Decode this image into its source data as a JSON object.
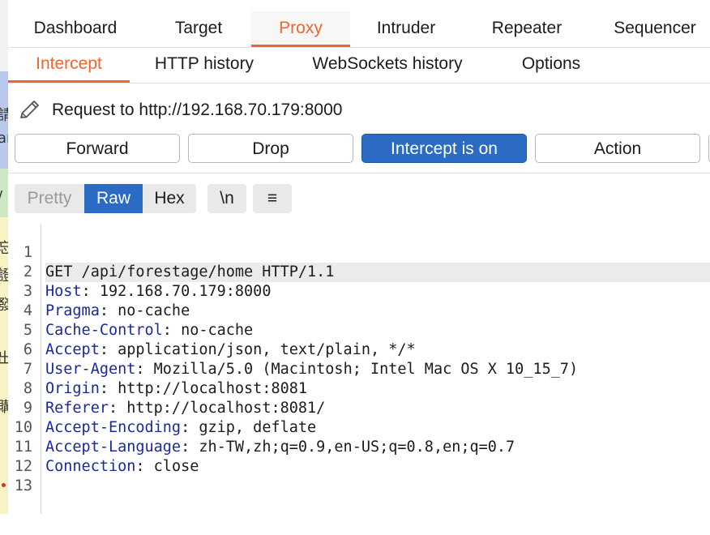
{
  "tabs": [
    {
      "label": "Dashboard"
    },
    {
      "label": "Target"
    },
    {
      "label": "Proxy"
    },
    {
      "label": "Intruder"
    },
    {
      "label": "Repeater"
    },
    {
      "label": "Sequencer"
    }
  ],
  "active_tab": "Proxy",
  "subtabs": [
    {
      "label": "Intercept"
    },
    {
      "label": "HTTP history"
    },
    {
      "label": "WebSockets history"
    },
    {
      "label": "Options"
    }
  ],
  "active_subtab": "Intercept",
  "request_title": "Request to http://192.168.70.179:8000",
  "buttons": {
    "forward": "Forward",
    "drop": "Drop",
    "intercept": "Intercept is on",
    "action": "Action"
  },
  "editor_modes": {
    "pretty": "Pretty",
    "raw": "Raw",
    "hex": "Hex",
    "newline": "\\n",
    "menu": "≡"
  },
  "active_mode": "Raw",
  "lines": [
    {
      "num": "1",
      "header": "",
      "value": "GET /api/forestage/home HTTP/1.1"
    },
    {
      "num": "2",
      "header": "Host",
      "value": ": 192.168.70.179:8000"
    },
    {
      "num": "3",
      "header": "Pragma",
      "value": ": no-cache"
    },
    {
      "num": "4",
      "header": "Cache-Control",
      "value": ": no-cache"
    },
    {
      "num": "5",
      "header": "Accept",
      "value": ": application/json, text/plain, */*"
    },
    {
      "num": "6",
      "header": "User-Agent",
      "value": ": Mozilla/5.0 (Macintosh; Intel Mac OS X 10_15_7)"
    },
    {
      "num": "7",
      "header": "Origin",
      "value": ": http://localhost:8081"
    },
    {
      "num": "8",
      "header": "Referer",
      "value": ": http://localhost:8081/"
    },
    {
      "num": "9",
      "header": "Accept-Encoding",
      "value": ": gzip, deflate"
    },
    {
      "num": "10",
      "header": "Accept-Language",
      "value": ": zh-TW,zh;q=0.9,en-US;q=0.8,en;q=0.7"
    },
    {
      "num": "11",
      "header": "Connection",
      "value": ": close"
    },
    {
      "num": "12",
      "header": "",
      "value": ""
    },
    {
      "num": "13",
      "header": "",
      "value": ""
    }
  ],
  "colors": {
    "accent": "#f06430",
    "primary_button": "#2b6bc4",
    "header_key": "#1a2a9e"
  },
  "left_edge_glyphs": [
    "請",
    "an",
    "/",
    "忘",
    "證",
    "發",
    "出",
    "購"
  ]
}
